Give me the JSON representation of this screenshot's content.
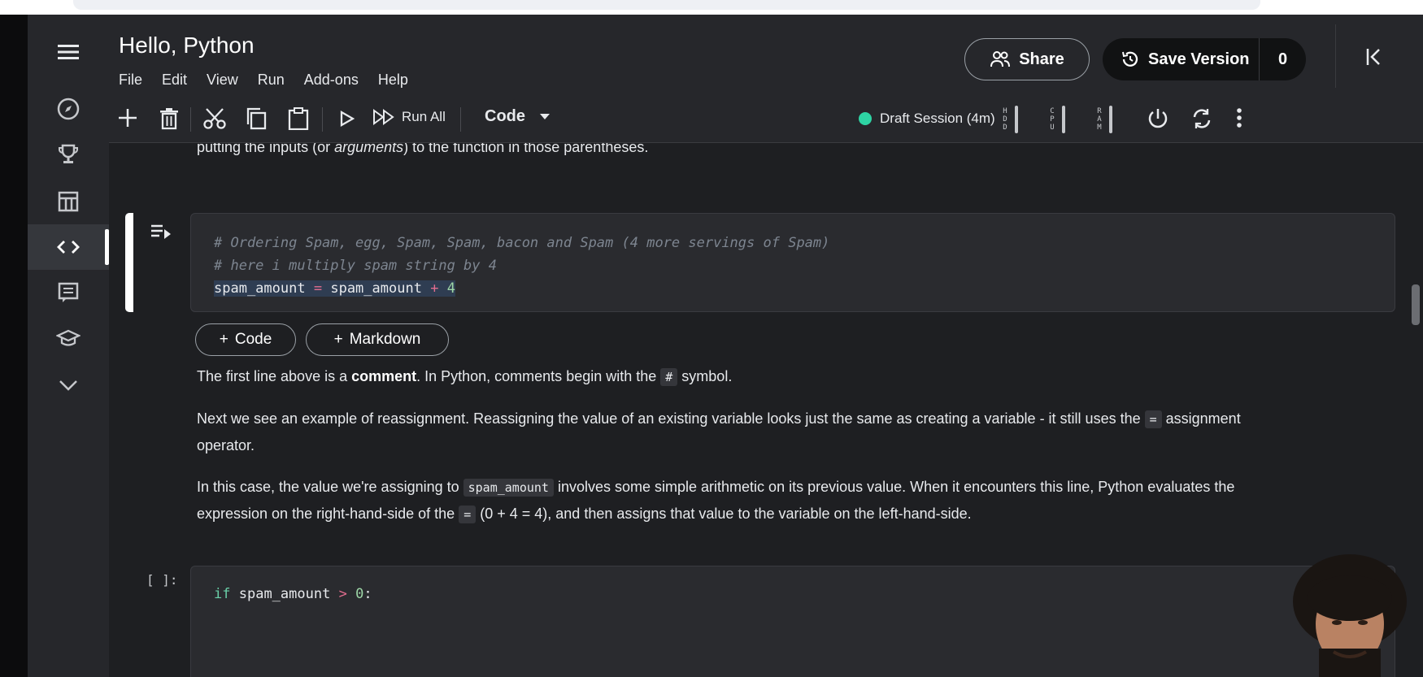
{
  "notebook": {
    "title": "Hello, Python"
  },
  "menu": [
    "File",
    "Edit",
    "View",
    "Run",
    "Add-ons",
    "Help"
  ],
  "header": {
    "share_label": "Share",
    "save_version_label": "Save Version",
    "save_version_count": "0"
  },
  "toolbar": {
    "run_all_label": "Run All",
    "cell_type": "Code",
    "session_label": "Draft Session (4m)",
    "meters": [
      {
        "label": "H\nD\nD"
      },
      {
        "label": "C\nP\nU"
      },
      {
        "label": "R\nA\nM"
      }
    ]
  },
  "content": {
    "md_top": "putting the inputs (or ",
    "md_top_em": "arguments",
    "md_top_tail": ") to the function in those parentheses.",
    "code_cell": {
      "line1": "# Ordering Spam, egg, Spam, Spam, bacon and Spam (4 more servings of Spam)",
      "line2": "# here i multiply spam string by 4",
      "line3_var": "spam_amount",
      "line3_eq": "=",
      "line3_var2": "spam_amount",
      "line3_op": "+",
      "line3_num": "4"
    },
    "add_code_label": "Code",
    "add_markdown_label": "Markdown",
    "p1_pre": "The first line above is a ",
    "p1_bold": "comment",
    "p1_mid": ". In Python, comments begin with the ",
    "p1_code": "#",
    "p1_post": " symbol.",
    "p2_pre": "Next we see an example of reassignment. Reassigning the value of an existing variable looks just the same as creating a variable - it still uses the ",
    "p2_code": "=",
    "p2_post": " assignment",
    "p2_line2": "operator.",
    "p3_pre": "In this case, the value we're assigning to ",
    "p3_code": "spam_amount",
    "p3_post": " involves some simple arithmetic on its previous value. When it encounters this line, Python evaluates the",
    "p3_line2_pre": "expression on the right-hand-side of the ",
    "p3_line2_code": "=",
    "p3_line2_post": " (0 + 4 = 4), and then assigns that value to the variable on the left-hand-side.",
    "cell2_prompt": "[ ]:",
    "cell2_kw": "if",
    "cell2_var": "spam_amount",
    "cell2_op": ">",
    "cell2_num": "0",
    "cell2_colon": ":"
  },
  "colors": {
    "background": "#1e1f22",
    "panel": "#26272b",
    "session_dot": "#2ed4a4",
    "operator": "#e26d8f",
    "number": "#9dd6a7"
  }
}
